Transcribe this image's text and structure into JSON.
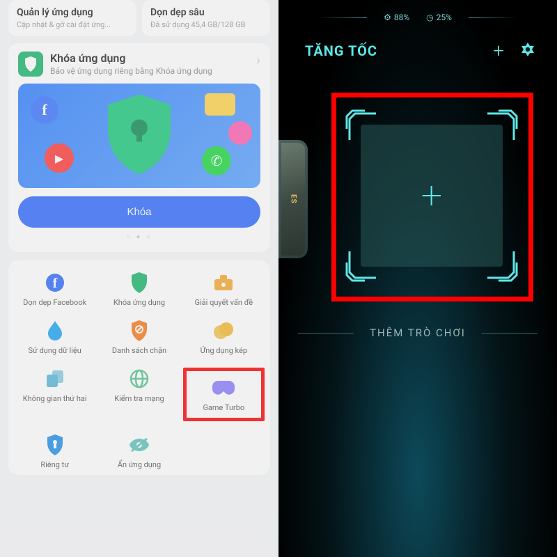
{
  "left": {
    "topCards": [
      {
        "title": "Quản lý ứng dụng",
        "sub": "Cập nhật & gỡ cài đặt ứng..."
      },
      {
        "title": "Dọn dẹp sâu",
        "sub": "Đã sử dụng 45,4 GB/128 GB"
      }
    ],
    "appLock": {
      "title": "Khóa ứng dụng",
      "sub": "Bảo vệ ứng dụng riêng bằng Khóa ứng dụng",
      "button": "Khóa"
    },
    "tools": [
      {
        "label": "Dọn dẹp Facebook",
        "icon": "facebook",
        "color": "#2f6aff"
      },
      {
        "label": "Khóa ứng dụng",
        "icon": "shield",
        "color": "#18b56a"
      },
      {
        "label": "Giải quyết vấn đề",
        "icon": "toolbox",
        "color": "#f4a830"
      },
      {
        "label": "Sử dụng dữ liệu",
        "icon": "drop",
        "color": "#1da5f4"
      },
      {
        "label": "Danh sách chặn",
        "icon": "block-shield",
        "color": "#f47a1d"
      },
      {
        "label": "Ứng dụng kép",
        "icon": "dual",
        "color": "#f4b830"
      },
      {
        "label": "Không gian thứ hai",
        "icon": "copy",
        "color": "#58b8d8"
      },
      {
        "label": "Kiểm tra mạng",
        "icon": "globe",
        "color": "#56c28e"
      },
      {
        "label": "Game Turbo",
        "icon": "gamepad",
        "color": "#8a7cff",
        "highlight": true
      },
      {
        "label": "Riêng tư",
        "icon": "privacy",
        "color": "#1f8fe9"
      },
      {
        "label": "Ẩn ứng dụng",
        "icon": "eye-off",
        "color": "#5bc4bb"
      }
    ]
  },
  "right": {
    "stats": {
      "first": "88%",
      "second": "25%"
    },
    "title": "TĂNG TỐC",
    "addGameLabel": "THÊM TRÒ CHƠI",
    "pubgText": "ES"
  },
  "colors": {
    "accent": "#5de8e8",
    "highlight": "#ff0000"
  }
}
